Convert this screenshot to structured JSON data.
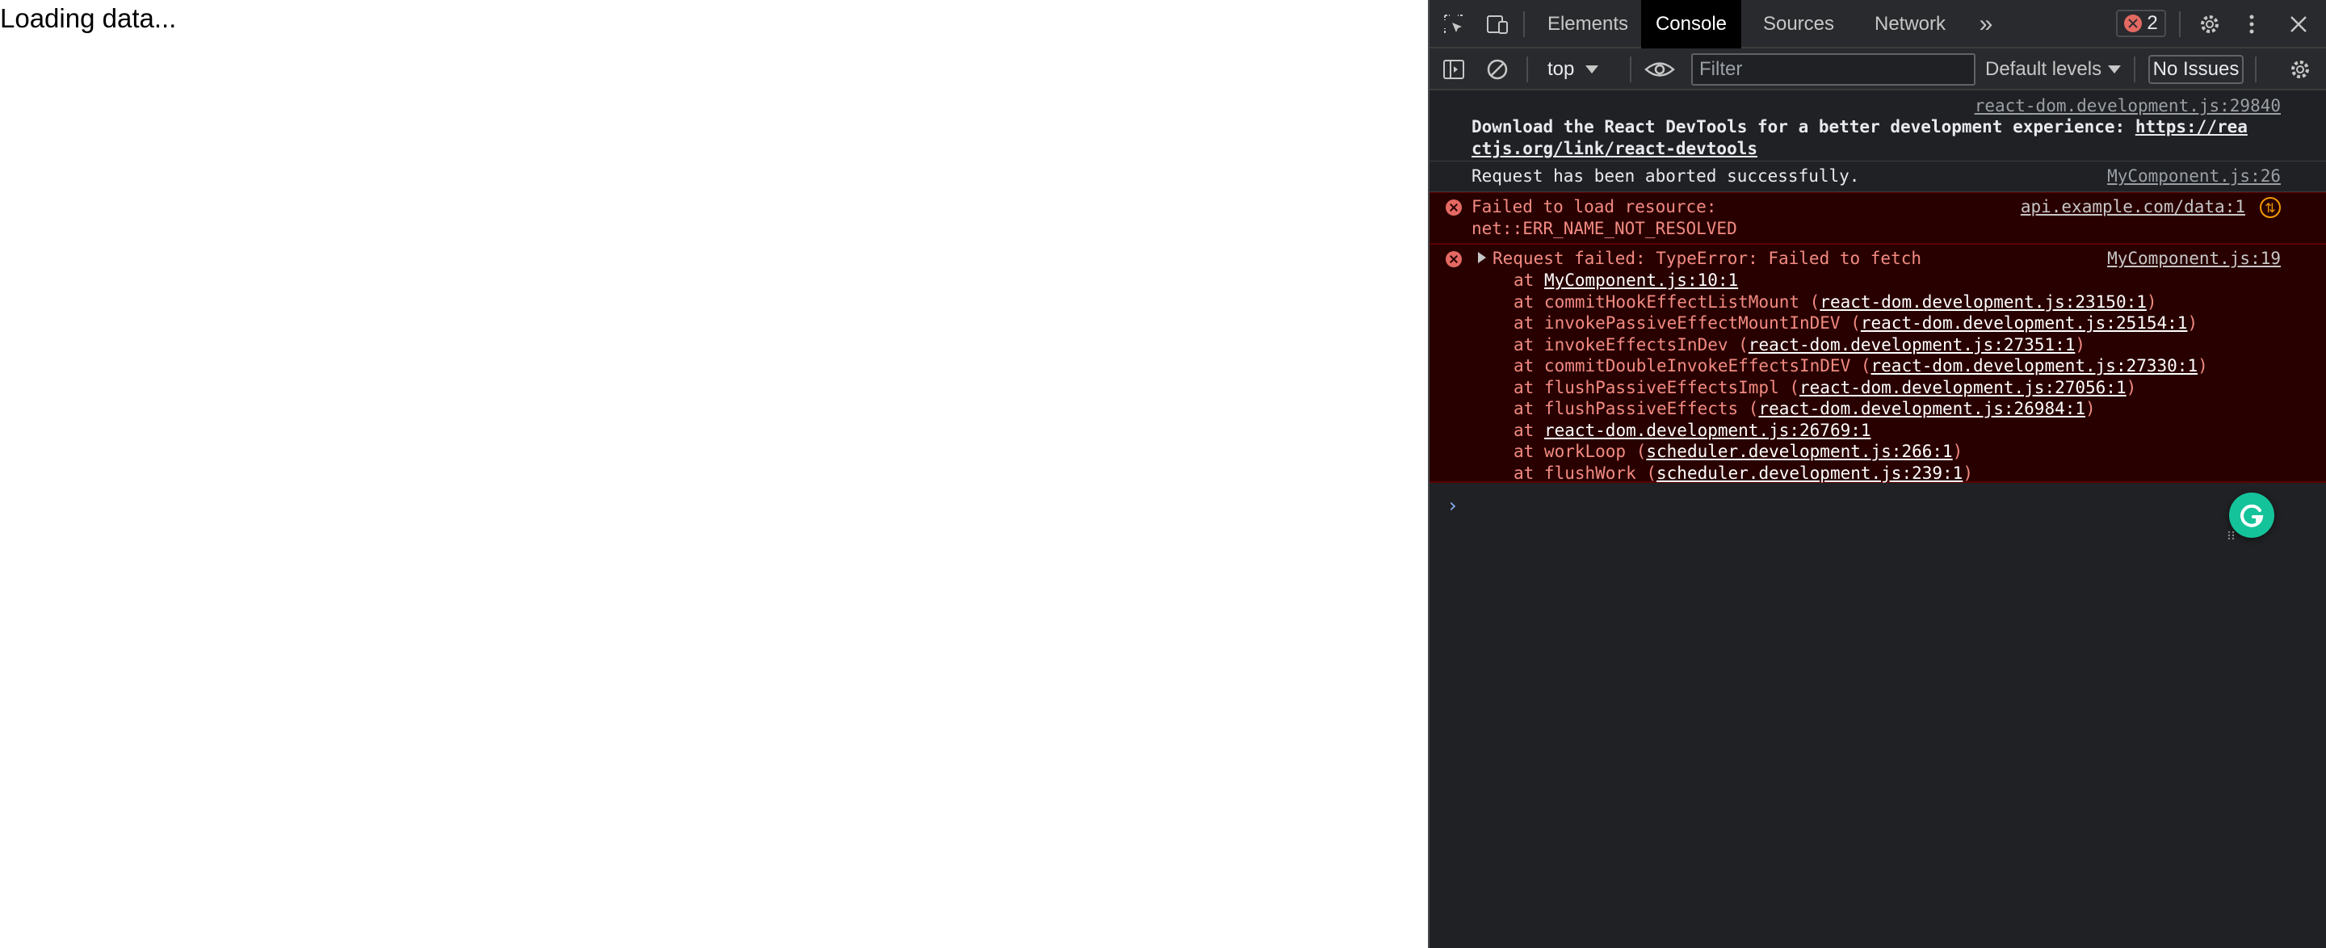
{
  "page": {
    "text": "Loading data..."
  },
  "devtools": {
    "tabs": [
      {
        "label": "Elements",
        "active": false
      },
      {
        "label": "Console",
        "active": true
      },
      {
        "label": "Sources",
        "active": false
      },
      {
        "label": "Network",
        "active": false
      }
    ],
    "more_tabs": "»",
    "error_count": "2",
    "toolbar": {
      "context": "top",
      "filter_placeholder": "Filter",
      "levels": "Default levels",
      "issues": "No Issues"
    },
    "messages": {
      "devtools_hint": {
        "source": "react-dom.development.js:29840",
        "text": "Download the React DevTools for a better development experience: ",
        "link_1": "https://rea",
        "link_2": "ctjs.org/link/react-devtools"
      },
      "aborted": {
        "text": "Request has been aborted successfully.",
        "source": "MyComponent.js:26"
      },
      "resource_error": {
        "line1": "Failed to load resource:",
        "line2": "net::ERR_NAME_NOT_RESOLVED",
        "source": "api.example.com/data:1"
      },
      "fetch_error": {
        "text": "Request failed: TypeError: Failed to fetch",
        "source": "MyComponent.js:19",
        "stack": [
          {
            "fn": "",
            "loc": "MyComponent.js:10:1"
          },
          {
            "fn": "commitHookEffectListMount",
            "loc": "react-dom.development.js:23150:1"
          },
          {
            "fn": "invokePassiveEffectMountInDEV",
            "loc": "react-dom.development.js:25154:1"
          },
          {
            "fn": "invokeEffectsInDev",
            "loc": "react-dom.development.js:27351:1"
          },
          {
            "fn": "commitDoubleInvokeEffectsInDEV",
            "loc": "react-dom.development.js:27330:1"
          },
          {
            "fn": "flushPassiveEffectsImpl",
            "loc": "react-dom.development.js:27056:1"
          },
          {
            "fn": "flushPassiveEffects",
            "loc": "react-dom.development.js:26984:1"
          },
          {
            "fn": "",
            "loc": "react-dom.development.js:26769:1"
          },
          {
            "fn": "workLoop",
            "loc": "scheduler.development.js:266:1"
          },
          {
            "fn": "flushWork",
            "loc": "scheduler.development.js:239:1"
          }
        ]
      }
    },
    "prompt": "›"
  },
  "colors": {
    "error_bg": "#290000",
    "error_text": "#f28b82",
    "grammarly": "#15c39a"
  }
}
